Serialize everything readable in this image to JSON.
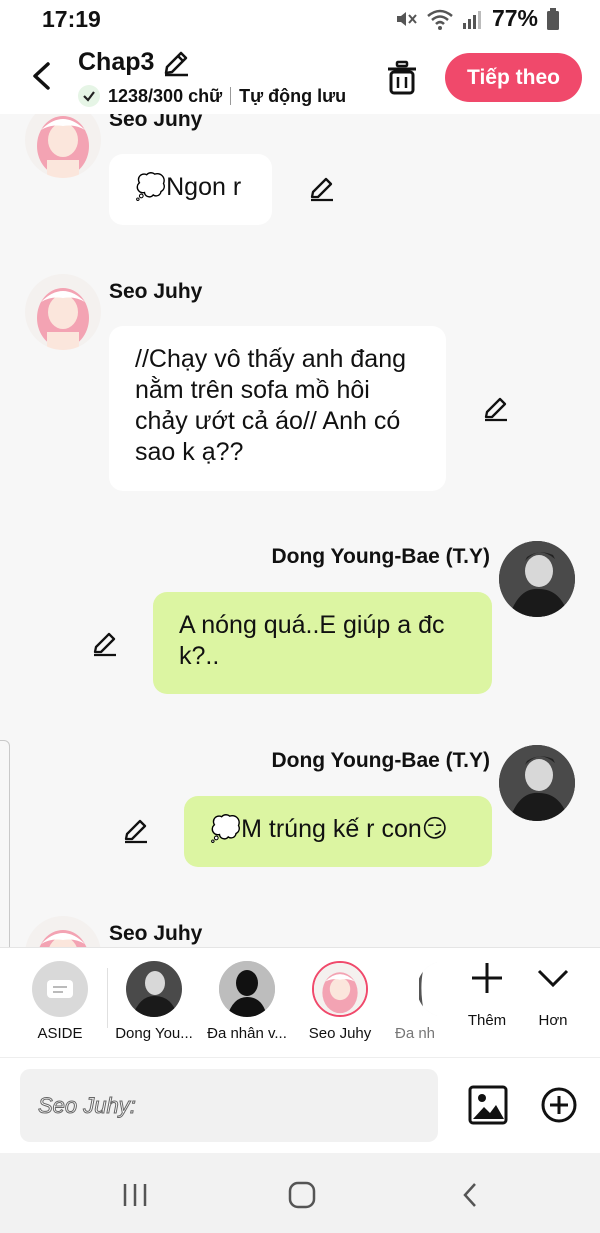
{
  "status": {
    "time": "17:19",
    "battery": "77%"
  },
  "header": {
    "title": "Chap3",
    "word_count": "1238/300 chữ",
    "autosave": "Tự động lưu",
    "next_label": "Tiếp theo"
  },
  "messages": [
    {
      "sender": "Seo Juhy",
      "text": "💭Ngon r"
    },
    {
      "sender": "Seo Juhy",
      "text": "//Chạy vô thấy anh đang nằm trên sofa mồ hôi chảy ướt cả áo// Anh có sao k ạ??"
    },
    {
      "sender": "Dong Young-Bae (T.Y)",
      "text": "A nóng quá..E giúp a đc k?.."
    },
    {
      "sender": "Dong Young-Bae (T.Y)",
      "text": "💭M trúng kế r con😏"
    },
    {
      "sender": "Seo Juhy",
      "text": ""
    }
  ],
  "characters": [
    {
      "label": "ASIDE",
      "icon": "aside-icon"
    },
    {
      "label": "Dong You..."
    },
    {
      "label": "Đa nhân v..."
    },
    {
      "label": "Seo Juhy"
    },
    {
      "label": "Đa nh"
    }
  ],
  "tools": {
    "add_label": "Thêm",
    "more_label": "Hơn"
  },
  "input": {
    "placeholder": "Seo Juhy:"
  },
  "colors": {
    "accent": "#f0496b",
    "right_bubble": "#dcf5a2",
    "left_bubble": "#ffffff"
  }
}
